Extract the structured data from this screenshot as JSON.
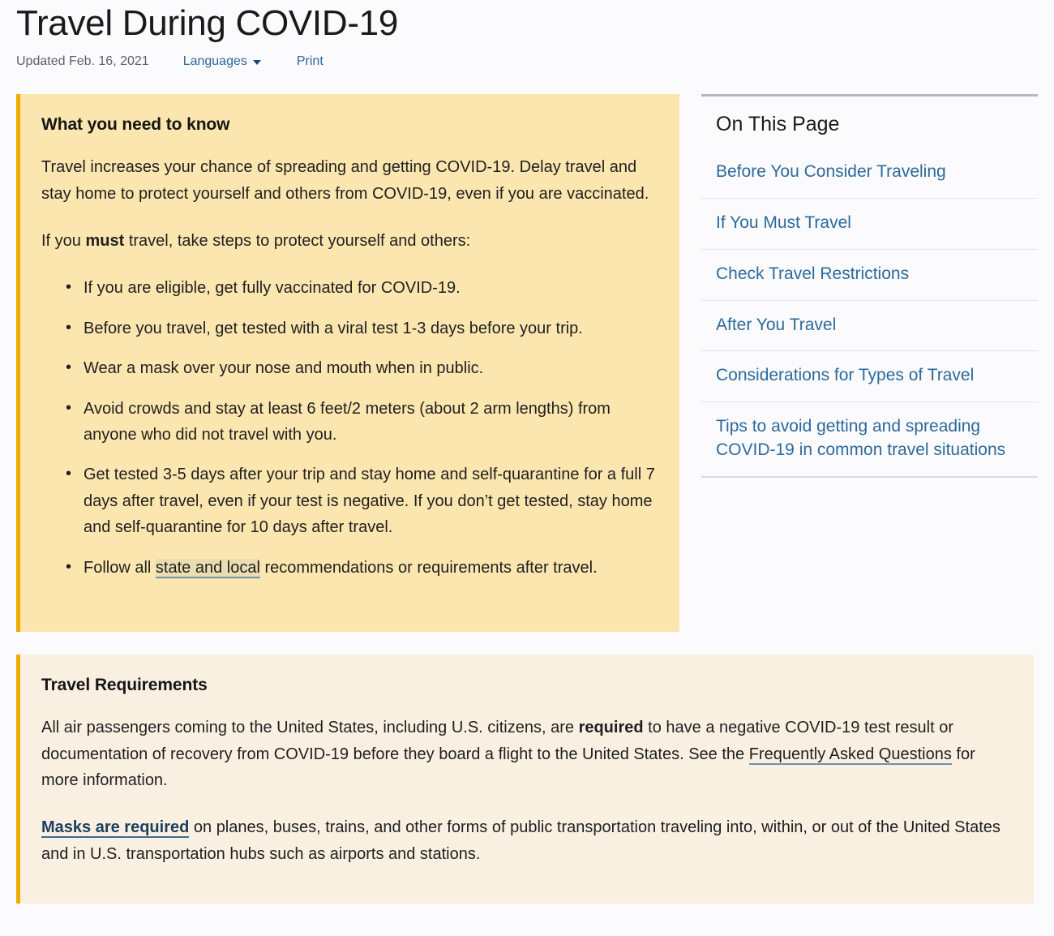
{
  "header": {
    "title": "Travel During COVID-19",
    "updated": "Updated Feb. 16, 2021",
    "languages_label": "Languages",
    "print_label": "Print"
  },
  "primary_callout": {
    "heading": "What you need to know",
    "paragraph_1": "Travel increases your chance of spreading and getting COVID-19. Delay travel and stay home to protect yourself and others from COVID-19, even if you are vaccinated.",
    "paragraph_2_before": "If you ",
    "paragraph_2_bold": "must",
    "paragraph_2_after": " travel, take steps to protect yourself and others:",
    "bullets": [
      {
        "text": "If you are eligible, get fully vaccinated for COVID-19."
      },
      {
        "text": "Before you travel, get tested with a viral test 1-3 days before your trip."
      },
      {
        "text": "Wear a mask over your nose and mouth when in public."
      },
      {
        "text": "Avoid crowds and stay at least 6 feet/2 meters (about 2 arm lengths) from anyone who did not travel with you."
      },
      {
        "text": "Get tested 3-5 days after your trip and stay home and self-quarantine for a full 7 days after travel, even if your test is negative. If you don’t get tested, stay home and self-quarantine for 10 days after travel."
      },
      {
        "text_before": "Follow all ",
        "link": "state and local",
        "text_after": " recommendations or requirements after travel."
      }
    ]
  },
  "secondary_callout": {
    "heading": "Travel Requirements",
    "paragraph_1_before": "All air passengers coming to the United States, including U.S. citizens, are ",
    "paragraph_1_bold": "required",
    "paragraph_1_mid": " to have a negative COVID-19 test result or documentation of recovery from COVID-19 before they board a flight to the United States. See the ",
    "paragraph_1_link": "Frequently Asked Questions",
    "paragraph_1_after": " for more information.",
    "paragraph_2_link": "Masks are required",
    "paragraph_2_after": " on planes, buses, trains, and other forms of public transportation traveling into, within, or out of the United States and in U.S. transportation hubs such as airports and stations."
  },
  "sidebar": {
    "title": "On This Page",
    "items": [
      {
        "label": "Before You Consider Traveling"
      },
      {
        "label": "If You Must Travel"
      },
      {
        "label": "Check Travel Restrictions"
      },
      {
        "label": "After You Travel"
      },
      {
        "label": "Considerations for Types of Travel"
      },
      {
        "label": "Tips to avoid getting and spreading COVID-19 in common travel situations"
      }
    ]
  },
  "colors": {
    "accent_bar": "#f0ab00",
    "primary_callout_bg": "#fce6af",
    "secondary_callout_bg": "#faf0e2",
    "link": "#2c6a9c",
    "page_bg": "#fbfafc"
  }
}
